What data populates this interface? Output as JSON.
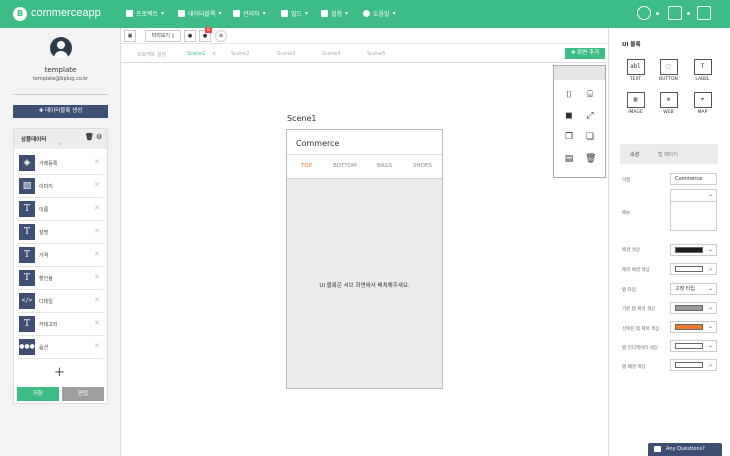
{
  "app": {
    "name": "commerceapp"
  },
  "nav": [
    "프로젝트",
    "데이터블록",
    "관리자",
    "빌드",
    "설정",
    "도움말"
  ],
  "user": {
    "name": "template",
    "email": "template@bplug.co.kr"
  },
  "sidebar": {
    "create_button": "✚ 데이터블록 생성",
    "panel_title": "상품데이터",
    "items": [
      {
        "icon": "tag-icon",
        "label": "거래등록"
      },
      {
        "icon": "image-icon",
        "label": "이미지"
      },
      {
        "icon": "text-icon",
        "label": "이름"
      },
      {
        "icon": "text-icon",
        "label": "설명"
      },
      {
        "icon": "text-icon",
        "label": "가격"
      },
      {
        "icon": "text-icon",
        "label": "할인율"
      },
      {
        "icon": "code-icon",
        "label": "디테일"
      },
      {
        "icon": "text-icon",
        "label": "카테고리"
      },
      {
        "icon": "dots-icon",
        "label": "옵션"
      }
    ],
    "save": "저장",
    "edit": "편집"
  },
  "toolbar": {
    "preview": "미리보기"
  },
  "scenes": {
    "tabs": [
      "프로젝트 설정",
      "Scene1",
      "Scene2",
      "Scene3",
      "Scene4",
      "Scene5"
    ],
    "active": "Scene1",
    "add_button": "✚ 화면 추가"
  },
  "canvas": {
    "scene_label": "Scene1",
    "phone_title": "Commerce",
    "phone_tabs": [
      "TOP",
      "BOTTOM",
      "BAGS",
      "SHOES"
    ],
    "message": "UI 블록은 서브 화면에서 배치해주세요."
  },
  "rightpanel": {
    "title": "UI 블록",
    "blocks": [
      {
        "icon": "abl",
        "label": "TEXT"
      },
      {
        "icon": "⬚",
        "label": "BUTTON"
      },
      {
        "icon": "T",
        "label": "LABEL"
      },
      {
        "icon": "▨",
        "label": "IMAGE"
      },
      {
        "icon": "⊕",
        "label": "WEB"
      },
      {
        "icon": "⌖",
        "label": "MAP"
      }
    ],
    "tabs": [
      "속성",
      "탭 페이지"
    ],
    "props": [
      {
        "label": "이름",
        "value": "Commerce"
      },
      {
        "label": "메뉴",
        "value": ""
      },
      {
        "label": "배경 색상",
        "color": "#1e1e1e"
      },
      {
        "label": "제목 배경 색상",
        "color": "#ffffff"
      },
      {
        "label": "탭 타입",
        "value": "고정 타입"
      },
      {
        "label": "기본 탭 제목 색상",
        "color": "#9a9a9a"
      },
      {
        "label": "선택된 탭 제목 색상",
        "color": "#f07b2d"
      },
      {
        "label": "탭 인디케이터 색상",
        "color": "#ffffff"
      },
      {
        "label": "탭 배경 색상",
        "color": "#ffffff"
      }
    ]
  },
  "chat": {
    "label": "Any Questions?"
  },
  "colors": {
    "accent": "#3dbc85",
    "navy": "#3d4f73",
    "orange": "#f07b2d"
  }
}
